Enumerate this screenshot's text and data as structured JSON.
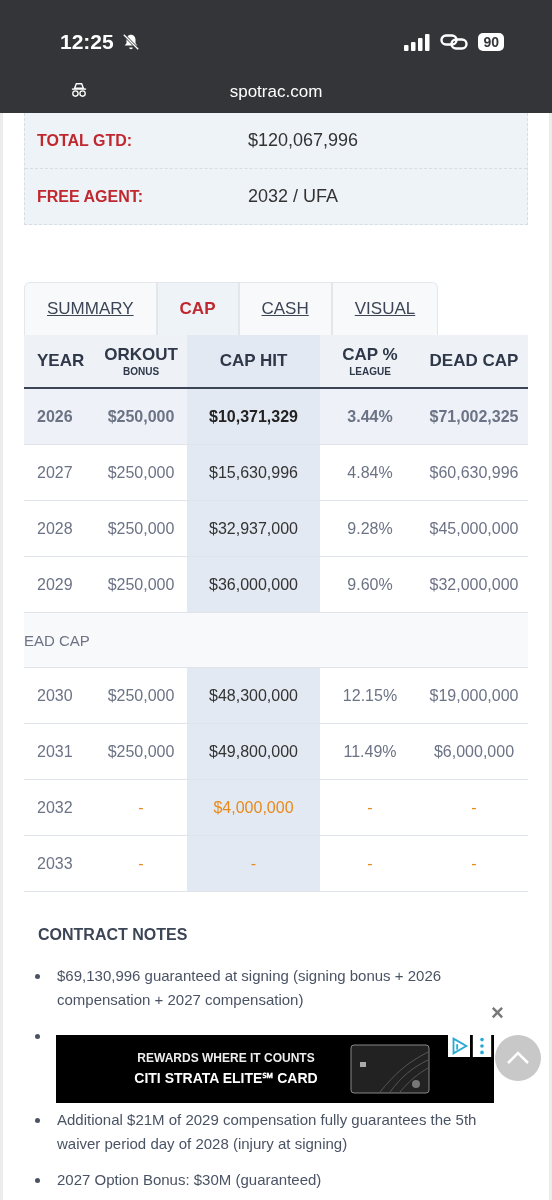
{
  "status_bar": {
    "time": "12:25",
    "battery": "90"
  },
  "browser": {
    "url": "spotrac.com"
  },
  "summary": [
    {
      "label": "TOTAL GTD:",
      "value": "$120,067,996"
    },
    {
      "label": "FREE AGENT:",
      "value": "2032 / UFA"
    }
  ],
  "tabs": [
    {
      "label": "SUMMARY",
      "selected": false
    },
    {
      "label": "CAP",
      "selected": true
    },
    {
      "label": "CASH",
      "selected": false
    },
    {
      "label": "VISUAL",
      "selected": false
    }
  ],
  "table": {
    "columns": [
      {
        "label": "YEAR"
      },
      {
        "label": "ORKOUT",
        "sub": "BONUS"
      },
      {
        "label": "CAP HIT"
      },
      {
        "label": "CAP %",
        "sub": "LEAGUE"
      },
      {
        "label": "DEAD CAP"
      }
    ],
    "rows": [
      {
        "kind": "current",
        "cells": [
          "2026",
          "$250,000",
          "$10,371,329",
          "3.44%",
          "$71,002,325"
        ]
      },
      {
        "kind": "normal",
        "cells": [
          "2027",
          "$250,000",
          "$15,630,996",
          "4.84%",
          "$60,630,996"
        ]
      },
      {
        "kind": "normal",
        "cells": [
          "2028",
          "$250,000",
          "$32,937,000",
          "9.28%",
          "$45,000,000"
        ]
      },
      {
        "kind": "normal",
        "cells": [
          "2029",
          "$250,000",
          "$36,000,000",
          "9.60%",
          "$32,000,000"
        ]
      },
      {
        "kind": "section",
        "label": "EAD CAP"
      },
      {
        "kind": "normal",
        "cells": [
          "2030",
          "$250,000",
          "$48,300,000",
          "12.15%",
          "$19,000,000"
        ]
      },
      {
        "kind": "normal",
        "cells": [
          "2031",
          "$250,000",
          "$49,800,000",
          "11.49%",
          "$6,000,000"
        ]
      },
      {
        "kind": "future",
        "cells": [
          "2032",
          "-",
          "$4,000,000",
          "-",
          "-"
        ]
      },
      {
        "kind": "future",
        "cells": [
          "2033",
          "-",
          "-",
          "-",
          "-"
        ]
      }
    ]
  },
  "notes": {
    "title": "CONTRACT NOTES",
    "items": [
      {
        "kind": "text",
        "text": "$69,130,996 guaranteed at signing (signing bonus + 2026 compensation + 2027 compensation)"
      },
      {
        "kind": "covered"
      },
      {
        "kind": "text",
        "text": "Additional $21M of 2029 compensation fully guarantees the 5th waiver period day of 2028 (injury at signing)"
      },
      {
        "kind": "text",
        "text": "2027 Option Bonus: $30M (guaranteed)"
      }
    ]
  },
  "ad": {
    "line_1": "REWARDS WHERE IT COUNTS",
    "line_2": "CITI STRATA ELITE℠ CARD",
    "close": "×"
  }
}
